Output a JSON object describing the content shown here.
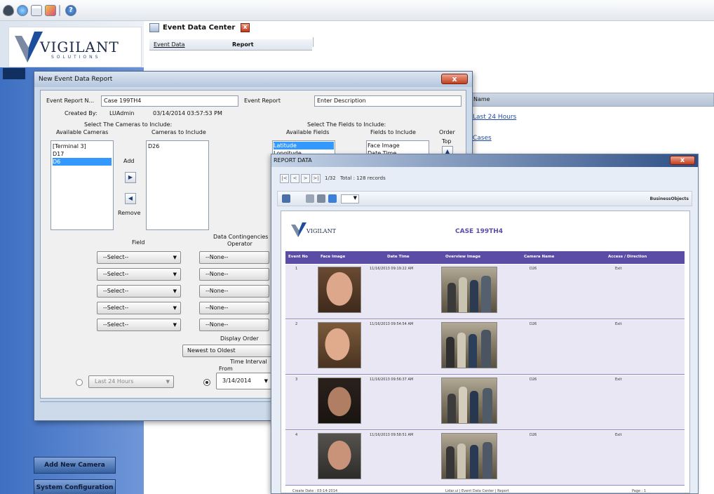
{
  "toolbar": {
    "icons": [
      "eye-icon",
      "globe-icon",
      "calendar-icon",
      "notes-icon",
      "help-icon"
    ]
  },
  "logo": {
    "text": "VIGILANT",
    "sub": "SOLUTIONS"
  },
  "sidebar": {
    "add_camera": "Add New Camera",
    "system_config": "System Configuration"
  },
  "main": {
    "window_title": "Event Data Center",
    "tabs": [
      "Event Data",
      "Report"
    ],
    "right_header": "Name",
    "right_links": [
      "Last 24 Hours",
      "Cases"
    ]
  },
  "dialog": {
    "title": "New Event Data Report",
    "event_report_name_label": "Event Report N...",
    "event_report_name_value": "Case 199TH4",
    "event_report_label": "Event Report",
    "description_value": "Enter Description",
    "created_by_label": "Created By:",
    "created_by_value": "LUAdmin",
    "created_date": "03/14/2014 03:57:53 PM",
    "cameras_header": "Select The Cameras to Include:",
    "available_cameras_label": "Available Cameras",
    "cameras_to_include_label": "Cameras to Include",
    "available_cameras": [
      "[Terminal 3]",
      "D17",
      "D6"
    ],
    "selected_available_camera": "D6",
    "included_cameras": [
      "D26"
    ],
    "add_label": "Add",
    "remove_label": "Remove",
    "fields_header": "Select The Fields to Include:",
    "available_fields_label": "Available Fields",
    "fields_to_include_label": "Fields to Include",
    "order_label": "Order",
    "top_label": "Top",
    "available_fields": [
      "Latitude",
      "Longitude"
    ],
    "selected_available_field": "Latitude",
    "included_fields": [
      "Face Image",
      "Date Time"
    ],
    "field_label": "Field",
    "contingencies_label": "Data Contingencies",
    "operator_label": "Operator",
    "field_selects": [
      "--Select--",
      "--Select--",
      "--Select--",
      "--Select--",
      "--Select--"
    ],
    "operator_selects": [
      "--None--",
      "--None--",
      "--None--",
      "--None--",
      "--None--"
    ],
    "display_order_label": "Display Order",
    "display_order_value": "Newest to Oldest",
    "time_interval_label": "Time Interval",
    "from_label": "From",
    "last24_value": "Last 24 Hours",
    "from_value": "3/14/2014"
  },
  "report": {
    "title": "REPORT DATA",
    "page_indicator": "1/32",
    "total_label": "Total : 128 records",
    "provider": "BusinessObjects",
    "logo_text": "VIGILANT",
    "case_title": "CASE 199TH4",
    "columns": [
      "Event No",
      "Face Image",
      "Date Time",
      "Overview Image",
      "Camera Name",
      "Access / Direction"
    ],
    "rows": [
      {
        "no": "1",
        "date": "11/16/2013 09:19:22 AM",
        "camera": "D26",
        "direction": "Exit"
      },
      {
        "no": "2",
        "date": "11/16/2013 09:54:54 AM",
        "camera": "D26",
        "direction": "Exit"
      },
      {
        "no": "3",
        "date": "11/16/2013 09:56:37 AM",
        "camera": "D26",
        "direction": "Exit"
      },
      {
        "no": "4",
        "date": "11/16/2013 09:58:51 AM",
        "camera": "D26",
        "direction": "Exit"
      }
    ],
    "footer_date": "Create Date : 03-14-2014",
    "footer_source": "Lidar.ui | Event Data Center | Report",
    "footer_page": "Page : 1"
  }
}
